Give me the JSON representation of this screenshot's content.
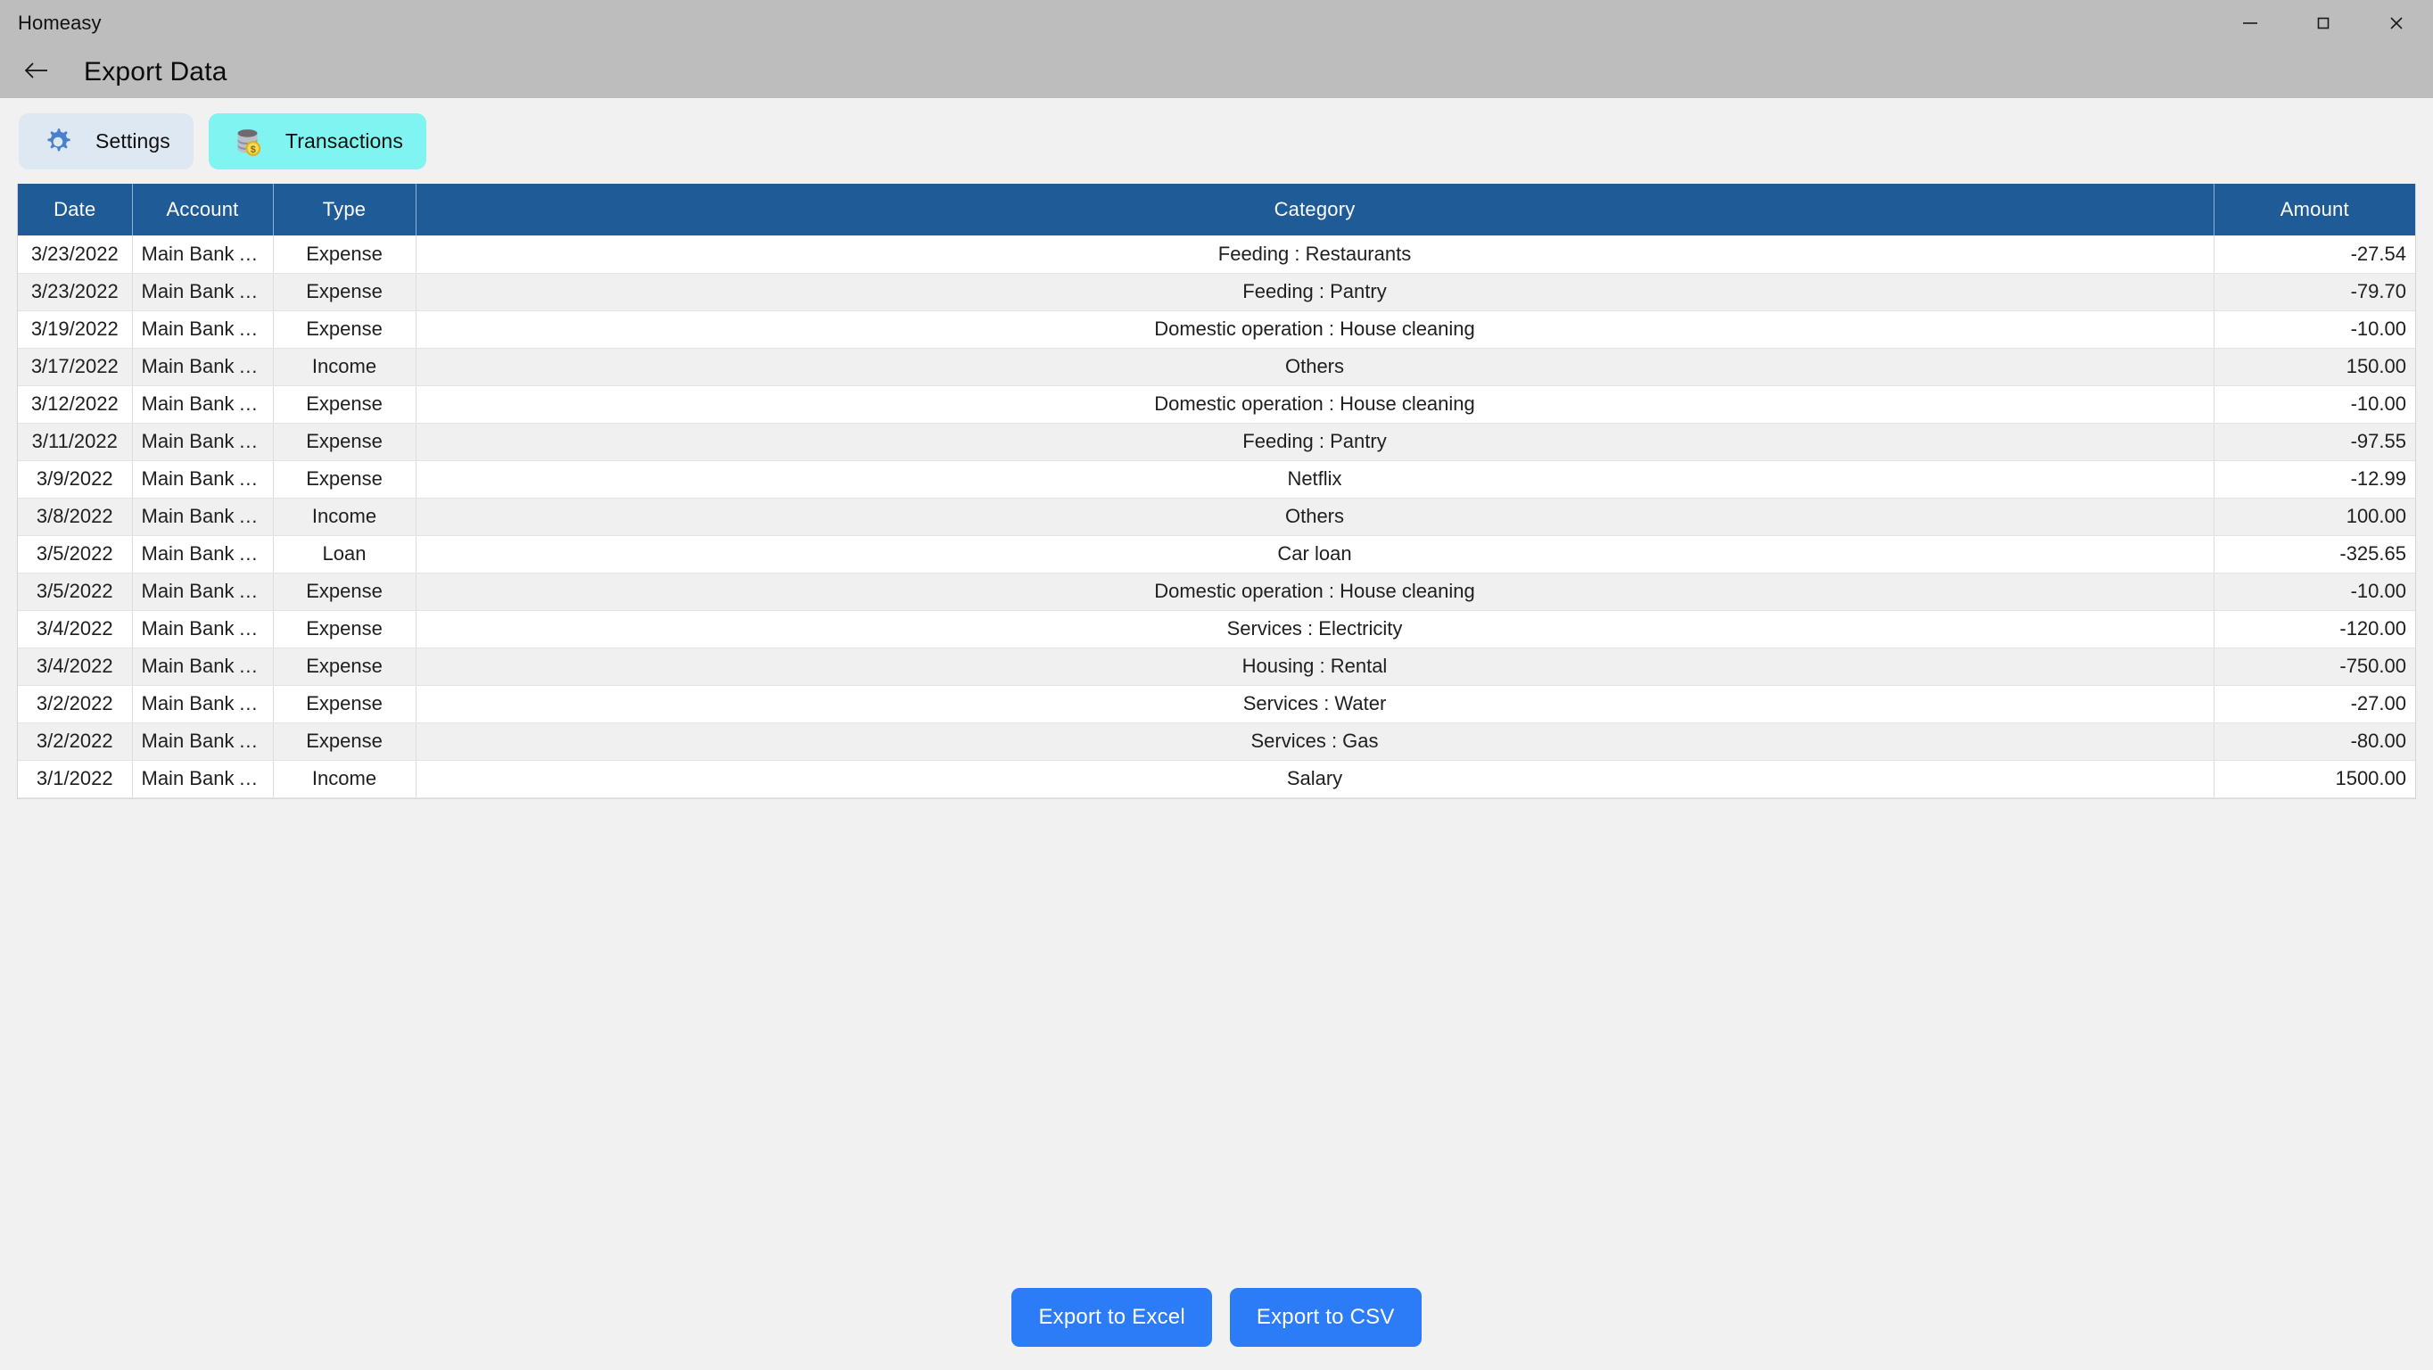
{
  "window": {
    "app_title": "Homeasy",
    "controls": {
      "minimize": "minimize-icon",
      "maximize": "maximize-icon",
      "close": "close-icon"
    }
  },
  "header": {
    "back_icon": "arrow-left-icon",
    "title": "Export Data"
  },
  "tabs": [
    {
      "id": "settings",
      "label": "Settings",
      "icon": "gear-icon",
      "active": false,
      "bg": "#dde8f2"
    },
    {
      "id": "transactions",
      "label": "Transactions",
      "icon": "database-coin-icon",
      "active": true,
      "bg": "#7ff4f0"
    }
  ],
  "table": {
    "header_bg": "#1f5b96",
    "columns": [
      "Date",
      "Account",
      "Type",
      "Category",
      "Amount"
    ],
    "rows": [
      {
        "date": "3/23/2022",
        "account": "Main Bank Account",
        "type": "Expense",
        "category": "Feeding : Restaurants",
        "amount": "-27.54"
      },
      {
        "date": "3/23/2022",
        "account": "Main Bank Account",
        "type": "Expense",
        "category": "Feeding : Pantry",
        "amount": "-79.70"
      },
      {
        "date": "3/19/2022",
        "account": "Main Bank Account",
        "type": "Expense",
        "category": "Domestic operation : House cleaning",
        "amount": "-10.00"
      },
      {
        "date": "3/17/2022",
        "account": "Main Bank Account",
        "type": "Income",
        "category": "Others",
        "amount": "150.00"
      },
      {
        "date": "3/12/2022",
        "account": "Main Bank Account",
        "type": "Expense",
        "category": "Domestic operation : House cleaning",
        "amount": "-10.00"
      },
      {
        "date": "3/11/2022",
        "account": "Main Bank Account",
        "type": "Expense",
        "category": "Feeding : Pantry",
        "amount": "-97.55"
      },
      {
        "date": "3/9/2022",
        "account": "Main Bank Account",
        "type": "Expense",
        "category": "Netflix",
        "amount": "-12.99"
      },
      {
        "date": "3/8/2022",
        "account": "Main Bank Account",
        "type": "Income",
        "category": "Others",
        "amount": "100.00"
      },
      {
        "date": "3/5/2022",
        "account": "Main Bank Account",
        "type": "Loan",
        "category": "Car loan",
        "amount": "-325.65"
      },
      {
        "date": "3/5/2022",
        "account": "Main Bank Account",
        "type": "Expense",
        "category": "Domestic operation : House cleaning",
        "amount": "-10.00"
      },
      {
        "date": "3/4/2022",
        "account": "Main Bank Account",
        "type": "Expense",
        "category": "Services : Electricity",
        "amount": "-120.00"
      },
      {
        "date": "3/4/2022",
        "account": "Main Bank Account",
        "type": "Expense",
        "category": "Housing : Rental",
        "amount": "-750.00"
      },
      {
        "date": "3/2/2022",
        "account": "Main Bank Account",
        "type": "Expense",
        "category": "Services : Water",
        "amount": "-27.00"
      },
      {
        "date": "3/2/2022",
        "account": "Main Bank Account",
        "type": "Expense",
        "category": "Services : Gas",
        "amount": "-80.00"
      },
      {
        "date": "3/1/2022",
        "account": "Main Bank Account",
        "type": "Income",
        "category": "Salary",
        "amount": "1500.00"
      }
    ]
  },
  "footer": {
    "export_excel_label": "Export to Excel",
    "export_csv_label": "Export to CSV",
    "button_color": "#2b7cf6"
  }
}
